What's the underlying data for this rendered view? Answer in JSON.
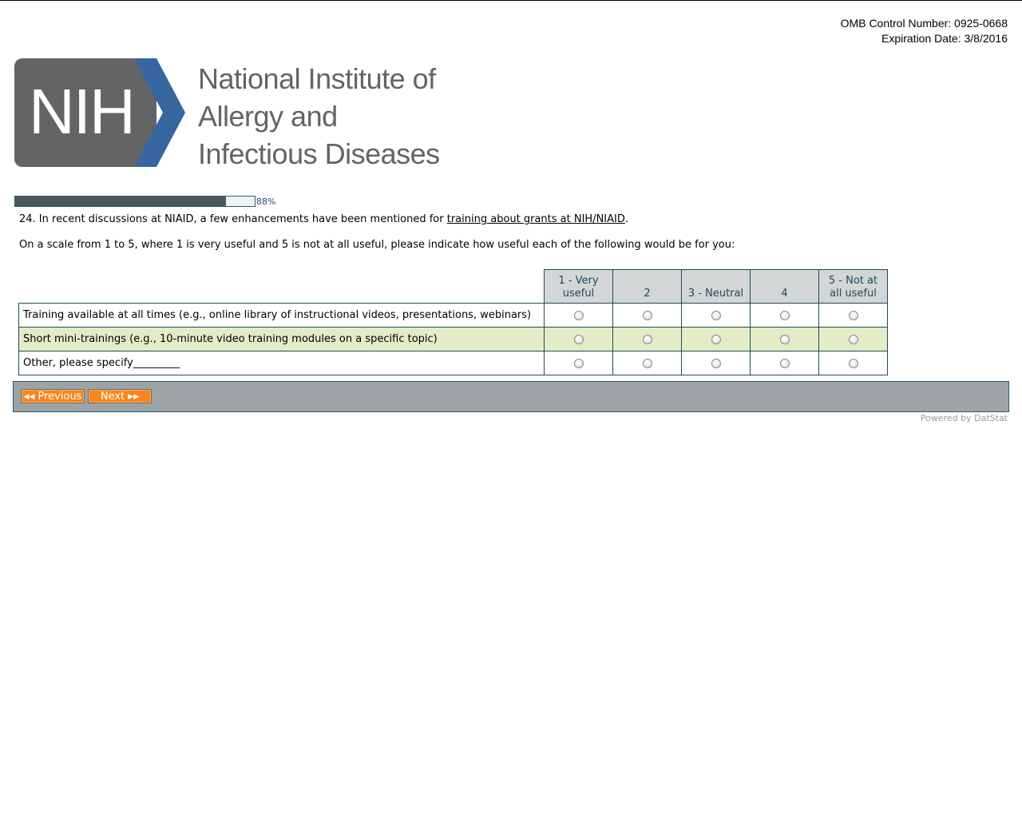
{
  "omb": {
    "control_number": "OMB Control Number: 0925-0668",
    "expiration": "Expiration Date: 3/8/2016"
  },
  "logo": {
    "mark": "NIH",
    "lines": [
      "National Institute of",
      "Allergy and",
      "Infectious Diseases"
    ],
    "mark_color": "#636466",
    "chevron_color": "#3566a0"
  },
  "progress": {
    "fraction": 0.88,
    "label": "88%"
  },
  "question": {
    "prefix": "24. In recent discussions at NIAID, a few enhancements have been mentioned for ",
    "underlined": "training about grants at NIH/NIAID",
    "suffix": ".",
    "instruction": "On a scale from 1 to 5, where 1 is very useful and 5 is not at all useful, please indicate how useful each of the following would be for you:"
  },
  "scale": {
    "columns": [
      {
        "line1": "1 - Very",
        "line2": "useful"
      },
      {
        "line1": "",
        "line2": "2"
      },
      {
        "line1": "",
        "line2": "3 - Neutral"
      },
      {
        "line1": "",
        "line2": "4"
      },
      {
        "line1": "5 - Not at",
        "line2": "all  useful"
      }
    ],
    "rows": [
      {
        "label": "Training available at all times (e.g., online library of instructional videos, presentations, webinars)"
      },
      {
        "label": "Short mini-trainings (e.g., 10-minute video training modules on a specific topic)"
      },
      {
        "label": "Other, please specify_________"
      }
    ],
    "alt_row_color": "#e2edc5",
    "header_color": "#d3d6d7"
  },
  "nav": {
    "previous_label": "Previous",
    "next_label": "Next",
    "button_color": "#f7861e",
    "bar_color": "#9ea3a6"
  },
  "footer": {
    "powered_by": "Powered by DatStat"
  }
}
